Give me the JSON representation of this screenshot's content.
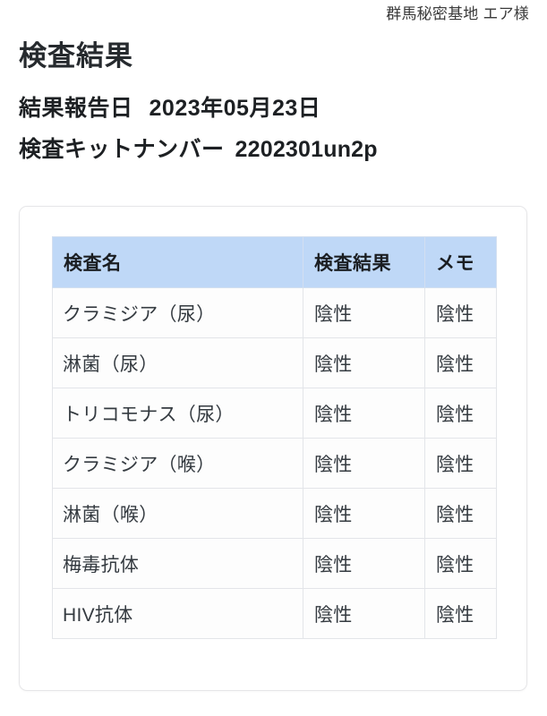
{
  "account": {
    "name": "群馬秘密基地 エア様"
  },
  "page": {
    "title": "検査結果"
  },
  "meta": {
    "report_date_label": "結果報告日",
    "report_date_value": "2023年05月23日",
    "kit_number_label": "検査キットナンバー",
    "kit_number_value": "2202301un2p"
  },
  "table": {
    "headers": {
      "test_name": "検査名",
      "test_result": "検査結果",
      "memo": "メモ"
    },
    "rows": [
      {
        "name": "クラミジア（尿）",
        "result": "陰性",
        "memo": "陰性"
      },
      {
        "name": "淋菌（尿）",
        "result": "陰性",
        "memo": "陰性"
      },
      {
        "name": "トリコモナス（尿）",
        "result": "陰性",
        "memo": "陰性"
      },
      {
        "name": "クラミジア（喉）",
        "result": "陰性",
        "memo": "陰性"
      },
      {
        "name": "淋菌（喉）",
        "result": "陰性",
        "memo": "陰性"
      },
      {
        "name": "梅毒抗体",
        "result": "陰性",
        "memo": "陰性"
      },
      {
        "name": "HIV抗体",
        "result": "陰性",
        "memo": "陰性"
      }
    ]
  },
  "colors": {
    "header_background": "#bfd8f7",
    "page_background": "#ffffff",
    "card_border": "#e6e6e8",
    "table_border": "#e3e5e9",
    "title_text": "#262a2e",
    "body_text": "#343a40"
  }
}
